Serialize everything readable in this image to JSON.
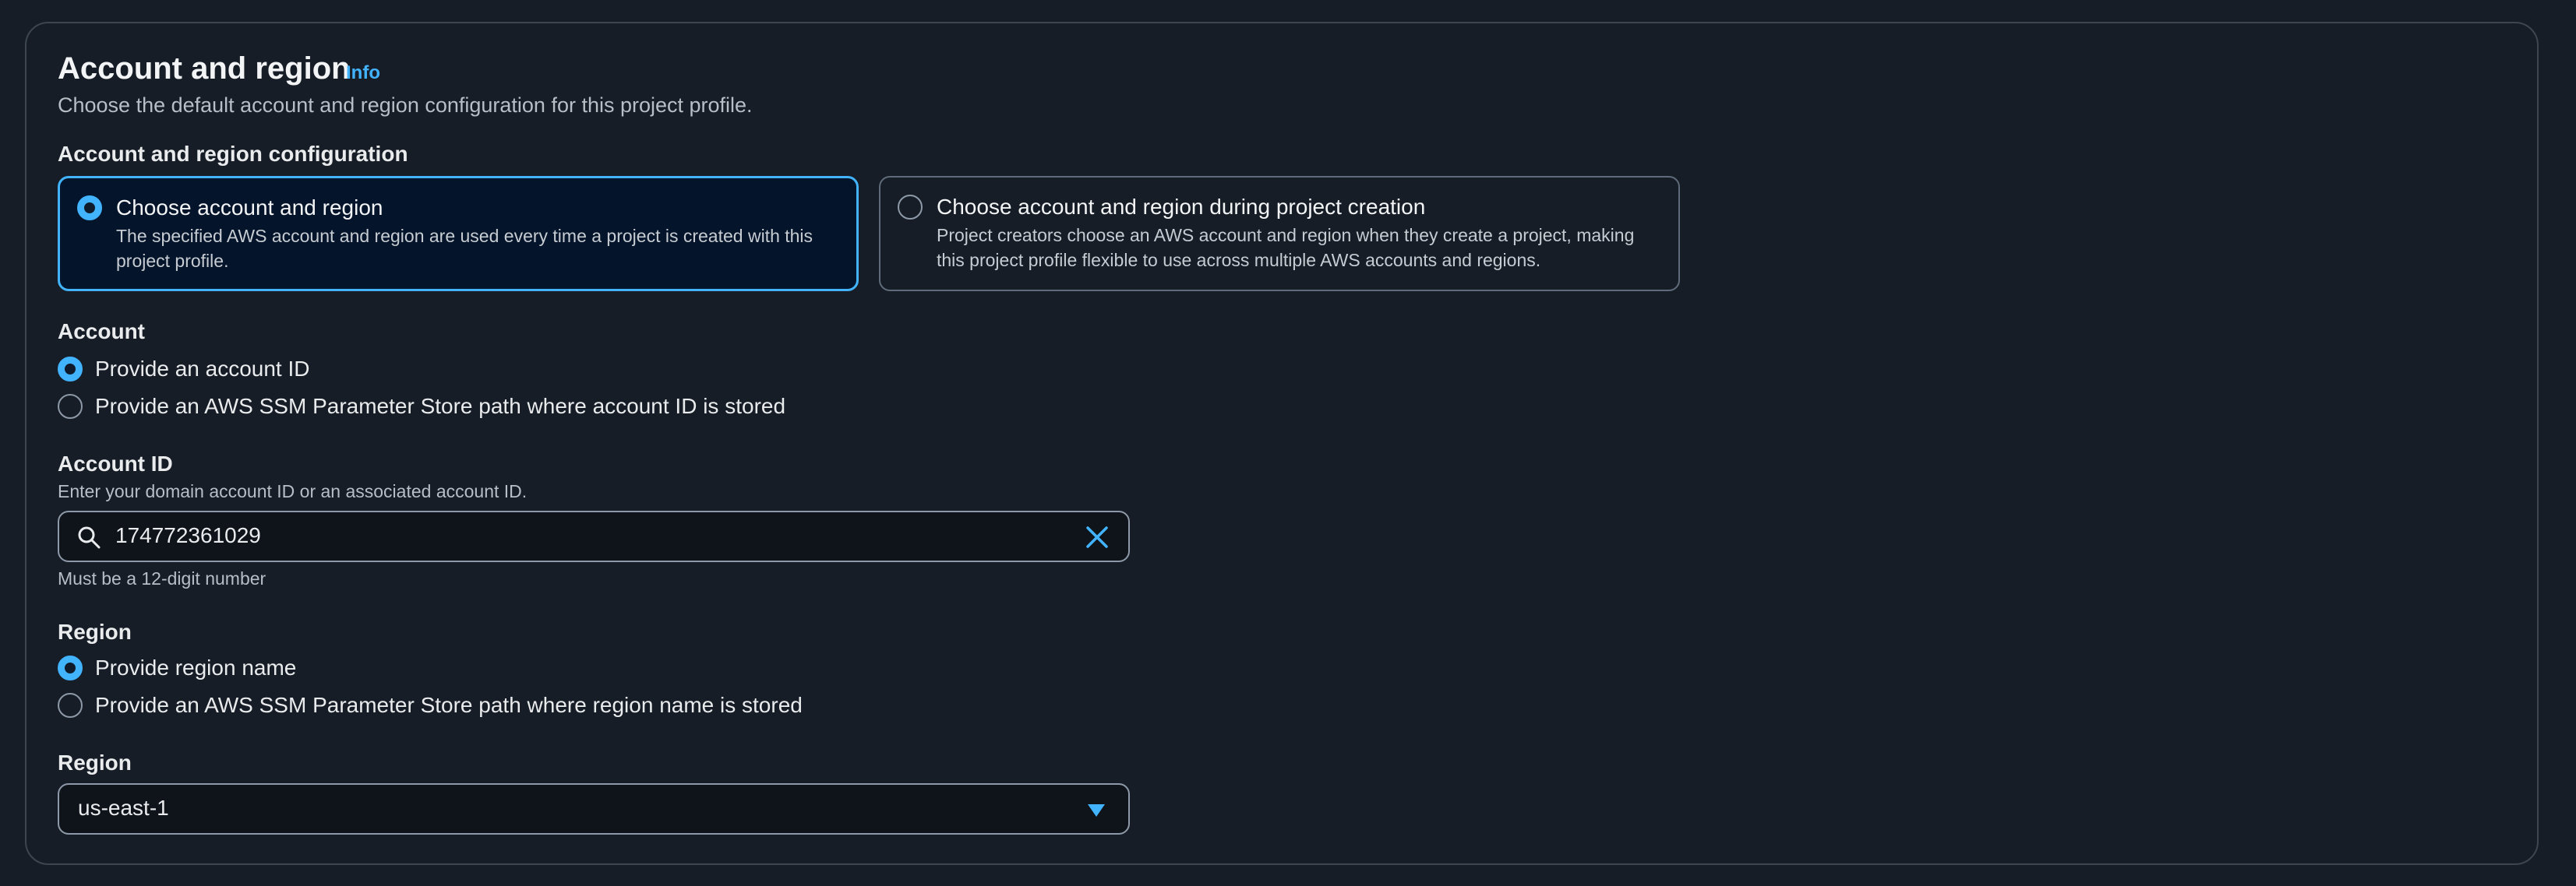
{
  "section": {
    "title": "Account and region",
    "info_link": "Info",
    "description": "Choose the default account and region configuration for this project profile."
  },
  "config": {
    "label": "Account and region configuration",
    "options": [
      {
        "title": "Choose account and region",
        "description": "The specified AWS account and region are used every time a project is created with this project profile.",
        "selected": true
      },
      {
        "title": "Choose account and region during project creation",
        "description": "Project creators choose an AWS account and region when they create a project, making this project profile flexible to use across multiple AWS accounts and regions.",
        "selected": false
      }
    ]
  },
  "account": {
    "label": "Account",
    "options": [
      {
        "label": "Provide an account ID",
        "selected": true
      },
      {
        "label": "Provide an AWS SSM Parameter Store path where account ID is stored",
        "selected": false
      }
    ]
  },
  "account_id": {
    "label": "Account ID",
    "description": "Enter your domain account ID or an associated account ID.",
    "value": "174772361029",
    "constraint": "Must be a 12-digit number"
  },
  "region_choice": {
    "label": "Region",
    "options": [
      {
        "label": "Provide region name",
        "selected": true
      },
      {
        "label": "Provide an AWS SSM Parameter Store path where region name is stored",
        "selected": false
      }
    ]
  },
  "region_select": {
    "label": "Region",
    "value": "us-east-1"
  },
  "colors": {
    "accent": "#42b4ff",
    "background": "#161d26",
    "border": "#3d4650"
  }
}
